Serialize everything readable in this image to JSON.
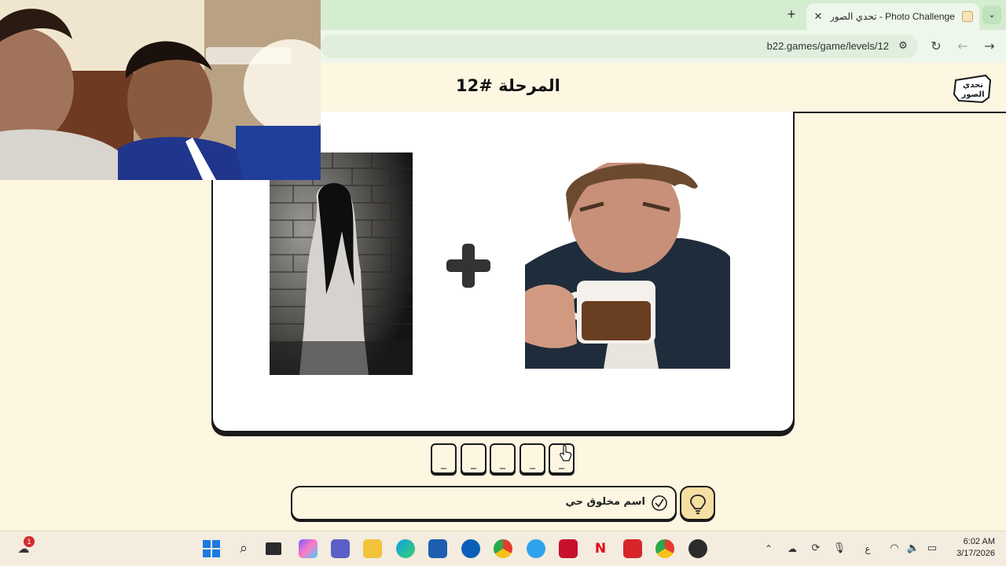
{
  "browser": {
    "tab_title": "Photo Challenge - تحدي الصور",
    "url": "b22.games/game/levels/12",
    "new_tab_label": "+",
    "tab_close_label": "✕"
  },
  "page": {
    "level_title": "المرحلة #12",
    "logo_text": "تحدي الصور"
  },
  "puzzle": {
    "operator": "+",
    "answer_slots": [
      "_",
      "_",
      "_",
      "_",
      "_"
    ],
    "hint_text": "اسم مخلوق حي"
  },
  "taskbar": {
    "notification_count": "1",
    "clock_time": "6:02 AM",
    "clock_date": "3/17/2026",
    "language_indicator": "ع"
  },
  "colors": {
    "page_bg": "#fdf6e1",
    "tab_strip": "#d4ecd0",
    "hint_button": "#f6dfa2",
    "outline": "#1a1a1a"
  }
}
